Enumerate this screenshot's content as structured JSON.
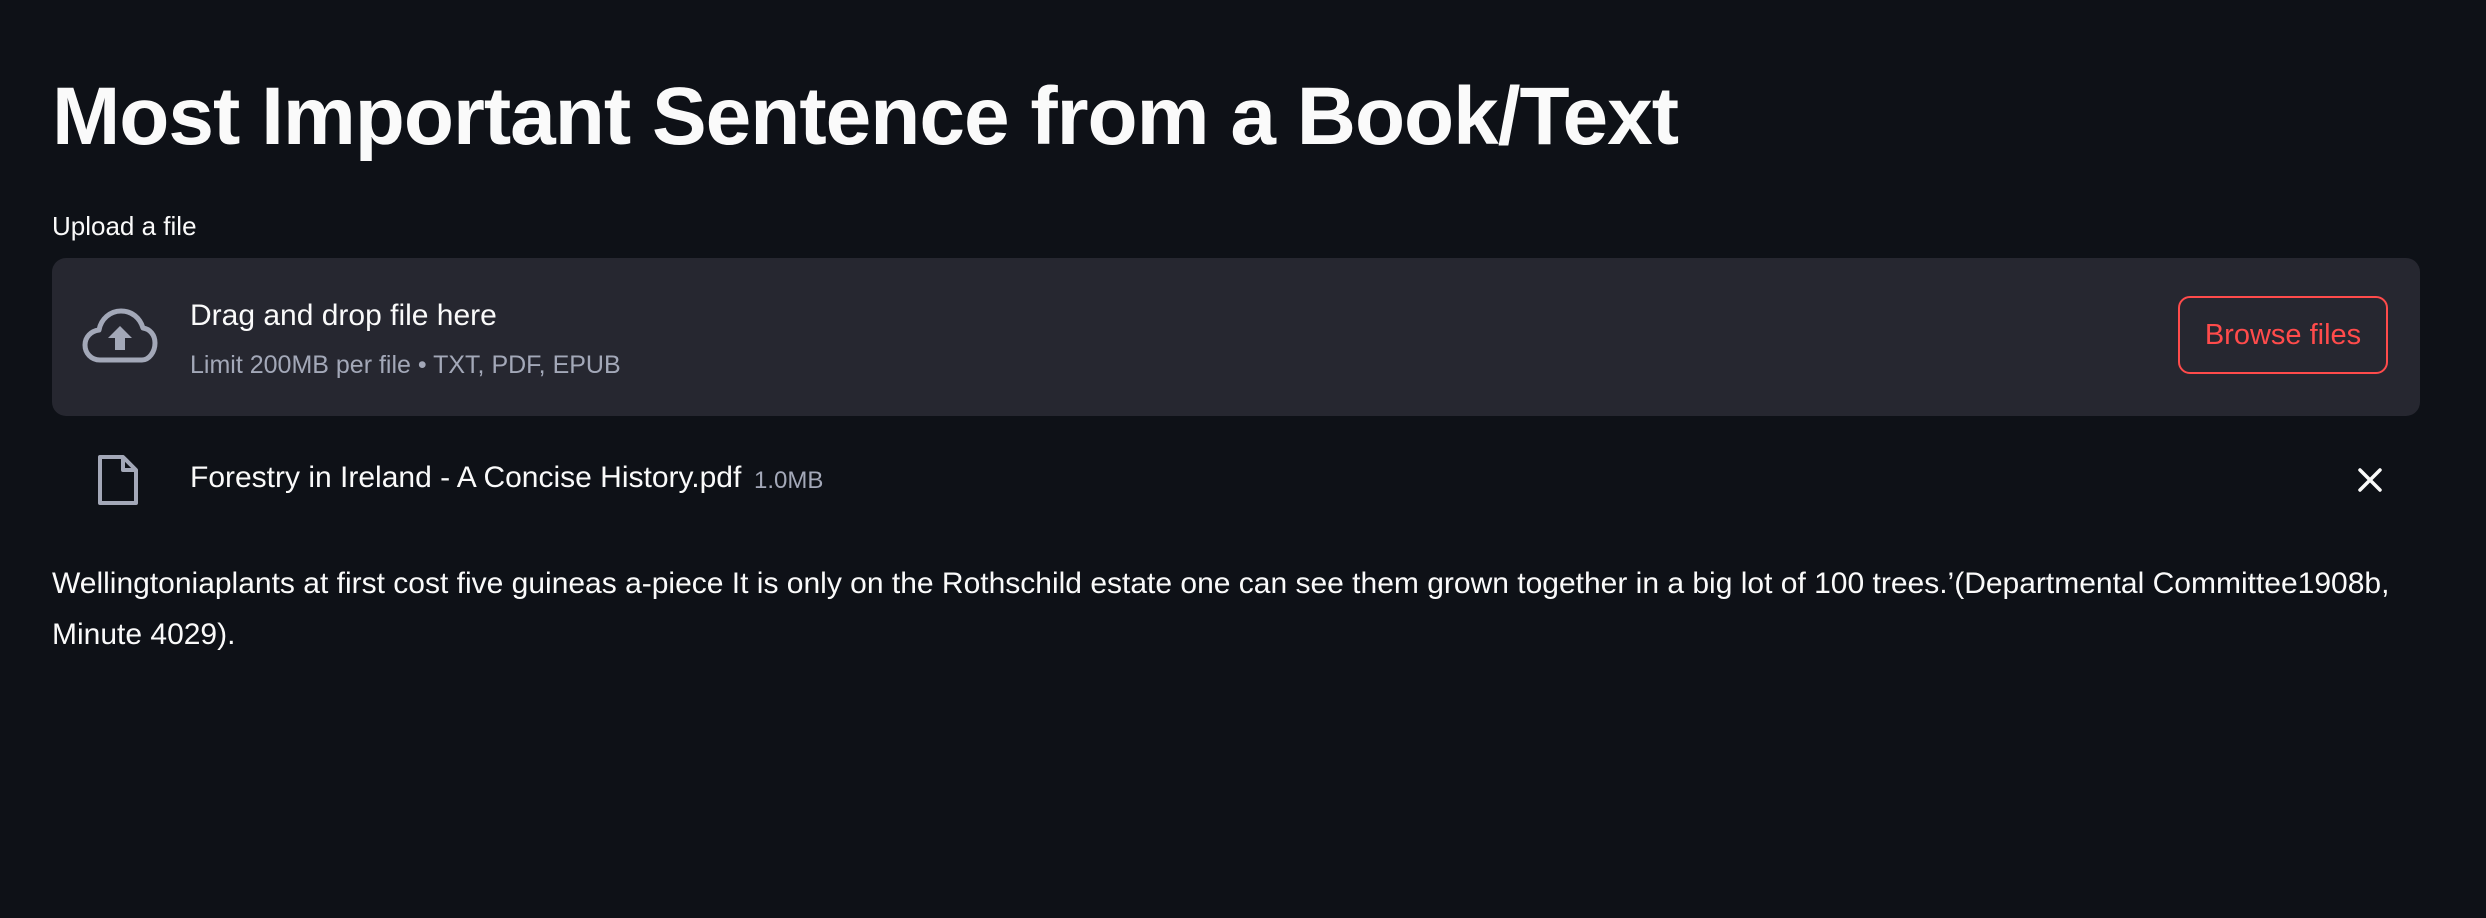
{
  "page": {
    "title": "Most Important Sentence from a Book/Text"
  },
  "uploader": {
    "label": "Upload a file",
    "drop_text": "Drag and drop file here",
    "limit_text": "Limit 200MB per file • TXT, PDF, EPUB",
    "browse_label": "Browse files",
    "icon": "cloud-upload-icon"
  },
  "uploaded_file": {
    "name": "Forestry in Ireland - A Concise History.pdf",
    "size": "1.0MB",
    "icon": "file-icon",
    "remove_icon": "close-icon"
  },
  "result": {
    "text": "Wellingtoniaplants at first cost five guineas a-piece It is only on the Rothschild estate one can see them grown together in a big lot of 100 trees.’(Departmental Committee1908b, Minute 4029)."
  },
  "colors": {
    "background": "#0e1117",
    "surface": "#262730",
    "text": "#fafafa",
    "muted_text": "#a3a8b8",
    "accent": "#ff4b4b",
    "icon": "#a3a8b8"
  }
}
